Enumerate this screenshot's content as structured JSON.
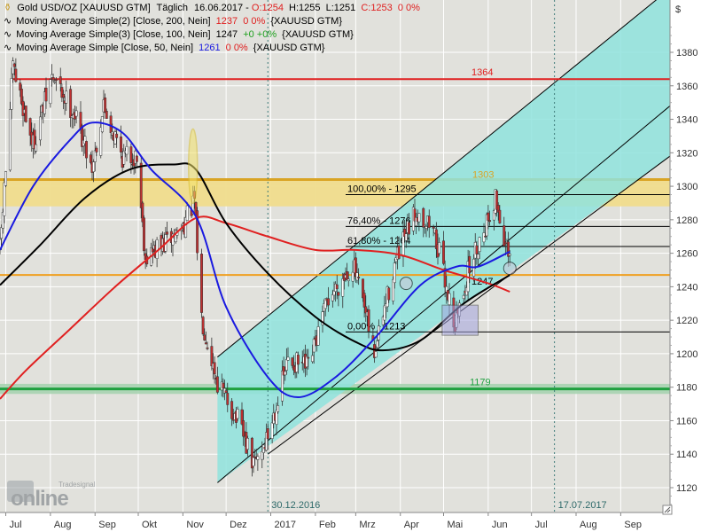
{
  "header": {
    "instrument": "Gold USD/OZ [XAUUSD GTM]",
    "interval": "Täglich",
    "date": "16.06.2017",
    "ohlc_open": "O:1254",
    "ohlc_high": "H:1255",
    "ohlc_low": "L:1251",
    "ohlc_close": "C:1253",
    "ohlc_change": "0 0%"
  },
  "indicators": [
    {
      "label": "Moving Average Simple(2) [Close, 200, Nein]",
      "value": "1237",
      "change": "0 0%",
      "source": "{XAUUSD GTM}",
      "color": "#e02020"
    },
    {
      "label": "Moving Average Simple(3) [Close, 100, Nein]",
      "value": "1247",
      "change": "+0 +0%",
      "source": "{XAUUSD GTM}",
      "color": "#000000"
    },
    {
      "label": "Moving Average Simple [Close, 50, Nein]",
      "value": "1261",
      "change": "0 0%",
      "source": "{XAUUSD GTM}",
      "color": "#1a1ae0"
    }
  ],
  "currency_symbol": "$",
  "watermark": {
    "brand": "online",
    "sub": "Tradesignal"
  },
  "colors": {
    "candle_up": "#ffffff",
    "candle_down": "#c03030",
    "ma200": "#e02020",
    "ma100": "#000000",
    "ma50": "#1a1ae0",
    "channel_fill": "#8fe3dd",
    "resistance_zone": "#f0dc8c",
    "level_1364": "#e02020",
    "level_1247": "#f0a020",
    "level_1179": "#20a040"
  },
  "chart_data": {
    "type": "candlestick",
    "ylim": [
      1110,
      1400
    ],
    "yticks": [
      1120,
      1140,
      1160,
      1180,
      1200,
      1220,
      1240,
      1260,
      1280,
      1300,
      1320,
      1340,
      1360,
      1380
    ],
    "xlim": [
      "2016-06-27",
      "2017-09-30"
    ],
    "x_ticks": [
      {
        "label": "Jul",
        "date": "2016-07-01"
      },
      {
        "label": "Aug",
        "date": "2016-08-01"
      },
      {
        "label": "Sep",
        "date": "2016-09-01"
      },
      {
        "label": "Okt",
        "date": "2016-10-01"
      },
      {
        "label": "Nov",
        "date": "2016-11-01"
      },
      {
        "label": "Dez",
        "date": "2016-12-01"
      },
      {
        "label": "2017",
        "date": "2017-01-01"
      },
      {
        "label": "Feb",
        "date": "2017-02-01"
      },
      {
        "label": "Mrz",
        "date": "2017-03-01"
      },
      {
        "label": "Apr",
        "date": "2017-04-01"
      },
      {
        "label": "Mai",
        "date": "2017-05-01"
      },
      {
        "label": "Jun",
        "date": "2017-06-01"
      },
      {
        "label": "Jul",
        "date": "2017-07-01"
      },
      {
        "label": "Aug",
        "date": "2017-08-01"
      },
      {
        "label": "Sep",
        "date": "2017-09-01"
      }
    ],
    "markers": [
      {
        "label": "30.12.2016",
        "date": "2016-12-30"
      },
      {
        "label": "17.07.2017",
        "date": "2017-07-17"
      }
    ],
    "levels": [
      {
        "label": "1364",
        "value": 1364,
        "kind": "resistance"
      },
      {
        "label": "1303",
        "value": 1303,
        "kind": "resistance"
      },
      {
        "label": "1247",
        "value": 1247,
        "kind": "support"
      },
      {
        "label": "1179",
        "value": 1179,
        "kind": "support"
      }
    ],
    "resistance_zone": [
      1288,
      1304
    ],
    "support_zone": [
      1176,
      1182
    ],
    "fibonacci": [
      {
        "label": "100,00% - 1295",
        "value": 1295
      },
      {
        "label": "76,40% - 1276",
        "value": 1276
      },
      {
        "label": "61,80% - 1264",
        "value": 1264
      },
      {
        "label": "0,00% - 1213",
        "value": 1213
      }
    ],
    "ohlc_anchors": [
      {
        "date": "2016-06-27",
        "close": 1262
      },
      {
        "date": "2016-07-06",
        "close": 1370
      },
      {
        "date": "2016-07-20",
        "close": 1325
      },
      {
        "date": "2016-08-02",
        "close": 1365
      },
      {
        "date": "2016-08-17",
        "close": 1345
      },
      {
        "date": "2016-08-30",
        "close": 1312
      },
      {
        "date": "2016-09-07",
        "close": 1348
      },
      {
        "date": "2016-09-20",
        "close": 1318
      },
      {
        "date": "2016-09-30",
        "close": 1318
      },
      {
        "date": "2016-10-06",
        "close": 1258
      },
      {
        "date": "2016-10-20",
        "close": 1266
      },
      {
        "date": "2016-10-31",
        "close": 1275
      },
      {
        "date": "2016-11-09",
        "close": 1290
      },
      {
        "date": "2016-11-14",
        "close": 1222
      },
      {
        "date": "2016-11-25",
        "close": 1183
      },
      {
        "date": "2016-12-09",
        "close": 1160
      },
      {
        "date": "2016-12-20",
        "close": 1133
      },
      {
        "date": "2016-12-30",
        "close": 1151
      },
      {
        "date": "2017-01-13",
        "close": 1196
      },
      {
        "date": "2017-01-27",
        "close": 1191
      },
      {
        "date": "2017-02-10",
        "close": 1233
      },
      {
        "date": "2017-02-27",
        "close": 1254
      },
      {
        "date": "2017-03-14",
        "close": 1200
      },
      {
        "date": "2017-03-28",
        "close": 1253
      },
      {
        "date": "2017-04-12",
        "close": 1285
      },
      {
        "date": "2017-04-24",
        "close": 1275
      },
      {
        "date": "2017-05-09",
        "close": 1217
      },
      {
        "date": "2017-05-19",
        "close": 1252
      },
      {
        "date": "2017-06-06",
        "close": 1293
      },
      {
        "date": "2017-06-16",
        "close": 1253
      }
    ],
    "series": [
      {
        "name": "Moving Average Simple(2) [Close, 200, Nein]",
        "key": "ma200",
        "points": [
          [
            "2016-06-27",
            1173
          ],
          [
            "2016-07-15",
            1190
          ],
          [
            "2016-08-15",
            1215
          ],
          [
            "2016-09-15",
            1240
          ],
          [
            "2016-10-15",
            1262
          ],
          [
            "2016-11-10",
            1281
          ],
          [
            "2016-12-01",
            1278
          ],
          [
            "2016-12-30",
            1270
          ],
          [
            "2017-02-01",
            1262
          ],
          [
            "2017-03-01",
            1262
          ],
          [
            "2017-04-01",
            1259
          ],
          [
            "2017-05-01",
            1250
          ],
          [
            "2017-06-01",
            1242
          ],
          [
            "2017-06-16",
            1237
          ]
        ]
      },
      {
        "name": "Moving Average Simple(3) [Close, 100, Nein]",
        "key": "ma100",
        "points": [
          [
            "2016-06-27",
            1241
          ],
          [
            "2016-07-25",
            1265
          ],
          [
            "2016-08-25",
            1293
          ],
          [
            "2016-09-25",
            1310
          ],
          [
            "2016-10-25",
            1313
          ],
          [
            "2016-11-10",
            1310
          ],
          [
            "2016-12-01",
            1278
          ],
          [
            "2016-12-30",
            1248
          ],
          [
            "2017-02-01",
            1222
          ],
          [
            "2017-03-01",
            1207
          ],
          [
            "2017-03-20",
            1202
          ],
          [
            "2017-04-15",
            1208
          ],
          [
            "2017-05-15",
            1230
          ],
          [
            "2017-06-16",
            1247
          ]
        ]
      },
      {
        "name": "Moving Average Simple [Close, 50, Nein]",
        "key": "ma50",
        "points": [
          [
            "2016-06-27",
            1262
          ],
          [
            "2016-07-20",
            1300
          ],
          [
            "2016-08-15",
            1328
          ],
          [
            "2016-08-30",
            1338
          ],
          [
            "2016-09-20",
            1332
          ],
          [
            "2016-10-10",
            1310
          ],
          [
            "2016-11-10",
            1282
          ],
          [
            "2016-12-01",
            1228
          ],
          [
            "2016-12-30",
            1186
          ],
          [
            "2017-01-20",
            1174
          ],
          [
            "2017-02-15",
            1186
          ],
          [
            "2017-03-15",
            1210
          ],
          [
            "2017-04-15",
            1241
          ],
          [
            "2017-05-10",
            1252
          ],
          [
            "2017-05-25",
            1252
          ],
          [
            "2017-06-16",
            1261
          ]
        ]
      }
    ]
  }
}
